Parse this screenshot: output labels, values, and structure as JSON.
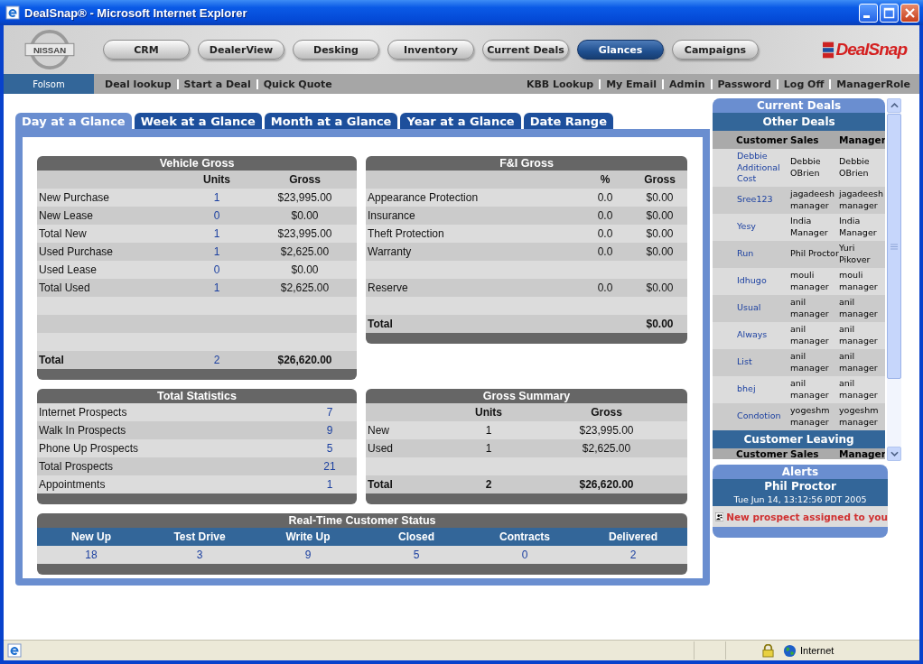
{
  "window": {
    "title": "DealSnap® - Microsoft Internet Explorer"
  },
  "header": {
    "brand_logo": "NISSAN",
    "product_logo": "DealSnap",
    "nav_buttons": [
      {
        "label": "CRM",
        "selected": false
      },
      {
        "label": "DealerView",
        "selected": false
      },
      {
        "label": "Desking",
        "selected": false
      },
      {
        "label": "Inventory",
        "selected": false
      },
      {
        "label": "Current Deals",
        "selected": false
      },
      {
        "label": "Glances",
        "selected": true
      },
      {
        "label": "Campaigns",
        "selected": false
      }
    ]
  },
  "subnav": {
    "location": "Folsom",
    "left_links": [
      "Deal lookup",
      "Start a Deal",
      "Quick Quote"
    ],
    "right_links": [
      "KBB Lookup",
      "My Email",
      "Admin",
      "Password",
      "Log Off",
      "ManagerRole"
    ]
  },
  "tabs": [
    {
      "label": "Day at a Glance",
      "selected": true
    },
    {
      "label": "Week at a Glance",
      "selected": false
    },
    {
      "label": "Month at a Glance",
      "selected": false
    },
    {
      "label": "Year at a Glance",
      "selected": false
    },
    {
      "label": "Date Range",
      "selected": false
    }
  ],
  "vehicle_gross": {
    "title": "Vehicle Gross",
    "columns": [
      "Units",
      "Gross"
    ],
    "rows": [
      {
        "kind": "item",
        "label": "New Purchase",
        "units": "1",
        "gross": "$23,995.00"
      },
      {
        "kind": "item",
        "label": "New Lease",
        "units": "0",
        "gross": "$0.00"
      },
      {
        "kind": "item",
        "label": "Total New",
        "units": "1",
        "gross": "$23,995.00"
      },
      {
        "kind": "item",
        "label": "Used Purchase",
        "units": "1",
        "gross": "$2,625.00"
      },
      {
        "kind": "item",
        "label": "Used Lease",
        "units": "0",
        "gross": "$0.00"
      },
      {
        "kind": "item",
        "label": "Total Used",
        "units": "1",
        "gross": "$2,625.00"
      },
      {
        "kind": "blank"
      },
      {
        "kind": "blank"
      },
      {
        "kind": "blank"
      },
      {
        "kind": "total",
        "label": "Total",
        "units": "2",
        "gross": "$26,620.00"
      }
    ]
  },
  "fi_gross": {
    "title": "F&I Gross",
    "columns": [
      "%",
      "Gross"
    ],
    "rows": [
      {
        "kind": "item",
        "label": "Appearance Protection",
        "percent": "0.0",
        "gross": "$0.00"
      },
      {
        "kind": "item",
        "label": "Insurance",
        "percent": "0.0",
        "gross": "$0.00"
      },
      {
        "kind": "item",
        "label": "Theft Protection",
        "percent": "0.0",
        "gross": "$0.00"
      },
      {
        "kind": "item",
        "label": "Warranty",
        "percent": "0.0",
        "gross": "$0.00"
      },
      {
        "kind": "blank"
      },
      {
        "kind": "item",
        "label": "Reserve",
        "percent": "0.0",
        "gross": "$0.00"
      },
      {
        "kind": "blank"
      },
      {
        "kind": "total",
        "label": "Total",
        "gross": "$0.00"
      }
    ]
  },
  "total_statistics": {
    "title": "Total Statistics",
    "rows": [
      {
        "label": "Internet Prospects",
        "value": "7"
      },
      {
        "label": "Walk In Prospects",
        "value": "9"
      },
      {
        "label": "Phone Up Prospects",
        "value": "5"
      },
      {
        "label": "Total Prospects",
        "value": "21"
      },
      {
        "label": "Appointments",
        "value": "1"
      }
    ]
  },
  "gross_summary": {
    "title": "Gross Summary",
    "columns": [
      "Units",
      "Gross"
    ],
    "rows": [
      {
        "kind": "item",
        "label": "New",
        "units": "1",
        "gross": "$23,995.00"
      },
      {
        "kind": "item",
        "label": "Used",
        "units": "1",
        "gross": "$2,625.00"
      },
      {
        "kind": "blank"
      },
      {
        "kind": "total",
        "label": "Total",
        "units": "2",
        "gross": "$26,620.00"
      }
    ]
  },
  "realtime_status": {
    "title": "Real-Time Customer Status",
    "columns": [
      {
        "label": "New Up",
        "value": "18"
      },
      {
        "label": "Test Drive",
        "value": "3"
      },
      {
        "label": "Write Up",
        "value": "9"
      },
      {
        "label": "Closed",
        "value": "5"
      },
      {
        "label": "Contracts",
        "value": "0"
      },
      {
        "label": "Delivered",
        "value": "2"
      }
    ]
  },
  "current_deals": {
    "title": "Current Deals",
    "other_deals": {
      "title": "Other Deals",
      "columns": [
        "Customer",
        "Sales",
        "Manager"
      ],
      "rows": [
        {
          "customer": "Debbie Additional Cost",
          "sales": "Debbie OBrien",
          "manager": "Debbie OBrien"
        },
        {
          "customer": "Sree123",
          "sales": "jagadeesh manager",
          "manager": "jagadeesh manager"
        },
        {
          "customer": "Yesy",
          "sales": "India Manager",
          "manager": "India Manager"
        },
        {
          "customer": "Run",
          "sales": "Phil Proctor",
          "manager": "Yuri Pikover"
        },
        {
          "customer": "Idhugo",
          "sales": "mouli manager",
          "manager": "mouli manager"
        },
        {
          "customer": "Usual",
          "sales": "anil manager",
          "manager": "anil manager"
        },
        {
          "customer": "Always",
          "sales": "anil manager",
          "manager": "anil manager"
        },
        {
          "customer": "List",
          "sales": "anil manager",
          "manager": "anil manager"
        },
        {
          "customer": "bhej",
          "sales": "anil manager",
          "manager": "anil manager"
        },
        {
          "customer": "Condotion",
          "sales": "yogeshm manager",
          "manager": "yogeshm manager"
        }
      ]
    },
    "customer_leaving": {
      "title": "Customer Leaving",
      "columns": [
        "Customer",
        "Sales",
        "Manager"
      ]
    }
  },
  "alerts": {
    "title": "Alerts",
    "name": "Phil Proctor",
    "time": "Tue Jun 14, 13:12:56 PDT 2005",
    "message": "New prospect assigned to you"
  },
  "status_bar": {
    "zone": "Internet"
  }
}
